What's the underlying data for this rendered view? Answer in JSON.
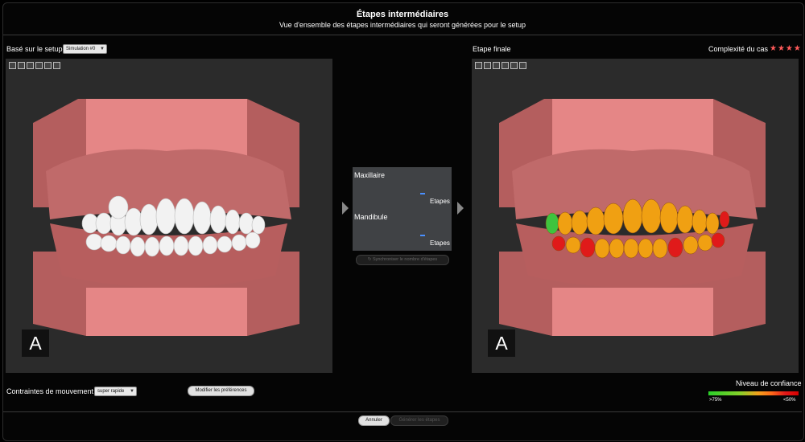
{
  "header": {
    "title": "Étapes intermédiaires",
    "subtitle": "Vue d'ensemble des étapes intermédiaires qui seront générées pour le setup"
  },
  "left": {
    "setup_label": "Basé sur le setup",
    "setup_value": "Simulation #0",
    "view_letter": "A"
  },
  "right": {
    "title": "Etape finale",
    "complexity_label": "Complexité du cas",
    "stars": "★★★★",
    "view_letter": "A"
  },
  "middle": {
    "maxillaire": "Maxillaire",
    "mandibule": "Mandibule",
    "etapes": "Etapes",
    "sync_label": "Synchroniser le nombre d'étapes"
  },
  "bottom": {
    "constraints_label": "Contraintes de mouvement",
    "constraints_value": "super rapide",
    "preferences_button": "Modifier les préférences",
    "confidence_label": "Niveau de confiance",
    "confidence_low": ">75%",
    "confidence_high": "<50%",
    "cancel": "Annuler",
    "generate": "Générer les étapes"
  },
  "colors": {
    "gum": "#c46e6e",
    "tooth_orange": "#f0a012",
    "tooth_red": "#e01a1a",
    "tooth_green": "#3ec43e"
  },
  "icons": [
    "view-front-icon",
    "view-top-icon",
    "view-left-icon",
    "view-right-icon",
    "view-bottom-icon",
    "view-3d-icon"
  ]
}
